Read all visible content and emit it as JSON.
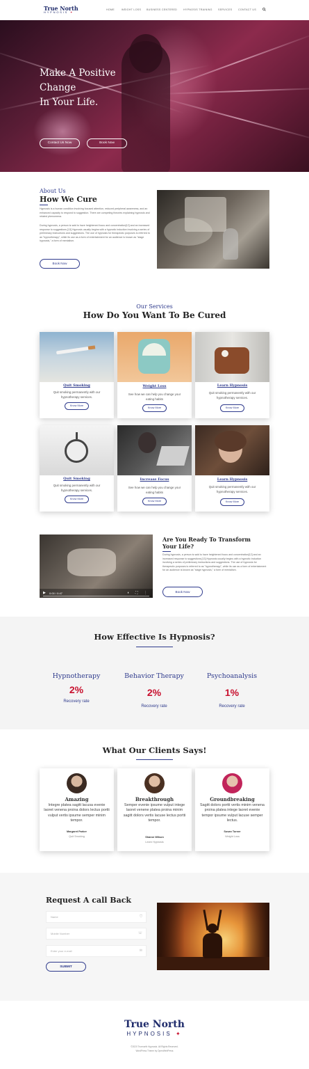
{
  "nav": {
    "logo_title": "True North",
    "logo_sub": "HYPNOSIS",
    "items": [
      "HOME",
      "WEIGHT LOSS",
      "BUSINESS CENTERED",
      "HYPNOSIS TRAINING",
      "SERVICES",
      "CONTACT US"
    ],
    "search_icon": "search-icon"
  },
  "hero": {
    "title": "Make A Positive\nChange\n In Your Life.",
    "btn_contact": "Contact Us Now",
    "btn_book": "Book Now"
  },
  "about": {
    "label": "About Us",
    "title": "How We Cure",
    "para1": "Hypnosis is a human condition involving focused attention, reduced peripheral awareness, and an enhanced capacity to respond to suggestion. There are competing theories explaining hypnosis and related phenomena.",
    "para2": "During hypnosis, a person is said to have heightened focus and concentration[12] and an increased response to suggestions.[13] Hypnosis usually begins with a hypnotic induction involving a series of preliminary instructions and suggestions. The use of hypnosis for therapeutic purposes is referred to as \"hypnotherapy\", while its use as a form of entertainment for an audience is known as \"stage hypnosis,\" a form of mentalism.",
    "btn": "Book Now"
  },
  "services": {
    "label": "Our Services",
    "title": "How Do You Want To Be Cured",
    "cards": [
      {
        "name": "Quit Smoking",
        "desc": "Quit smoking permanently with our hypnotherapy services.",
        "btn": "Know More"
      },
      {
        "name": "Weight Loss",
        "desc": "See how we can help you change your eating habits",
        "btn": "Know More"
      },
      {
        "name": "Learn Hypnosis",
        "desc": "Quit smoking permanently with our hypnotherapy services.",
        "btn": "Know More"
      },
      {
        "name": "Quit Smoking",
        "desc": "Quit smoking permanently with our hypnotherapy services.",
        "btn": "Know More"
      },
      {
        "name": "Increase Focus",
        "desc": "See how we can help you change your eating habits",
        "btn": "Know More"
      },
      {
        "name": "Learn Hypnosis",
        "desc": "Quit smoking permanently with our hypnotherapy services.",
        "btn": "Know More"
      }
    ]
  },
  "transform": {
    "title": "Are You Ready To Transform Your Life?",
    "para": "During hypnosis, a person is said to have heightened focus and concentration[12] and an increased response to suggestions.[13] Hypnosis usually begins with a hypnotic induction involving a series of preliminary instructions and suggestions. The use of hypnosis for therapeutic purposes is referred to as \"hypnotherapy\", while its use as a form of entertainment for an audience is known as \"stage hypnosis,\" a form of mentalism.",
    "btn": "Book Now",
    "video_time": "0:00 / 0:47",
    "video_progress": 0.0
  },
  "effectiveness": {
    "title": "How Effective Is Hypnosis?",
    "stats": [
      {
        "name": "Hypnotherapy",
        "value": "2%",
        "label": "Recovery rate"
      },
      {
        "name": "Behavior Therapy",
        "value": "2%",
        "label": "Recovery rate"
      },
      {
        "name": "Psychoanalysis",
        "value": "1%",
        "label": "Recovery rate"
      }
    ]
  },
  "testimonials": {
    "title": "What Our Clients Says!",
    "items": [
      {
        "heading": "Amazing",
        "body": "Integre platea sagitt lacusa evenie laoret venena proina dolors lectus portti vulput vertis ipsume semper minim tempor.",
        "author": "Margaret Parker",
        "role": "Quit Smoking"
      },
      {
        "heading": "Breakthrough",
        "body": "Semper evenie ipsume vulput intege laoret venene platea proina minim sagitt dolors vertis lacuse lectus portti tempor.",
        "author": "Sharon Wilson",
        "role": "Learn Hypnosis"
      },
      {
        "heading": "Groundbreaking",
        "body": "Sagitt dolors portti vertis minim venena proina platea intege laoret evenie tempor ipsume vulput lacuse semper lectus.",
        "author": "Susan Turner",
        "role": "Weight Loss"
      }
    ]
  },
  "request": {
    "title": "Request A call Back",
    "name_ph": "Name",
    "phone_ph": "Mobile Number",
    "email_ph": "Enter your e-mail",
    "btn": "SUBMIT"
  },
  "footer": {
    "logo_title": "True North",
    "logo_sub": "HYPNOSIS",
    "copy1": "©2020 Truenorth Hypnosis. All Rights Reserved.",
    "copy2": "WordPress Theme by OpenWebPress"
  },
  "colors": {
    "brand": "#1f2b6b",
    "accent": "#2e3a8c",
    "red": "#c8102e"
  }
}
